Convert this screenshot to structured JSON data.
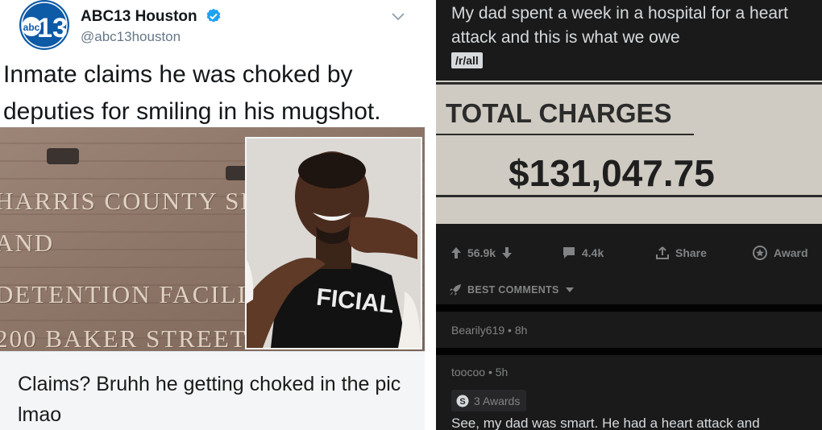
{
  "tweet": {
    "account_name": "ABC13 Houston",
    "handle": "@abc13houston",
    "logo_text": "abc",
    "logo_number": "13",
    "text": "Inmate claims he was choked by deputies for smiling in his mugshot.",
    "photo_sign_lines": [
      "HARRIS COUNTY SHE",
      "AND",
      "DETENTION FACILITY",
      "200 BAKER STREET"
    ],
    "shirt_text": "FICIAL",
    "reply_text": "Claims? Bruhh he getting choked in the pic lmao"
  },
  "post": {
    "title": "My dad spent a week in a hospital for a heart attack and this is what we owe",
    "flair": "/r/all",
    "bill_label": "TOTAL CHARGES",
    "bill_amount": "$131,047.75",
    "upvotes": "56.9k",
    "comments": "4.4k",
    "share_label": "Share",
    "award_label": "Award",
    "sort_label": "BEST COMMENTS"
  },
  "comments": [
    {
      "author": "Bearily619",
      "age": "8h"
    },
    {
      "author": "toocoo",
      "age": "5h",
      "awards": "3 Awards",
      "body": "See, my dad was smart. He had a heart attack and"
    }
  ],
  "colors": {
    "twitter_verified": "#1da1f2",
    "abc_logo": "#0d5aa7",
    "reddit_bg": "#1a1a1b",
    "reddit_text": "#d7dadc",
    "reddit_muted": "#818384"
  }
}
